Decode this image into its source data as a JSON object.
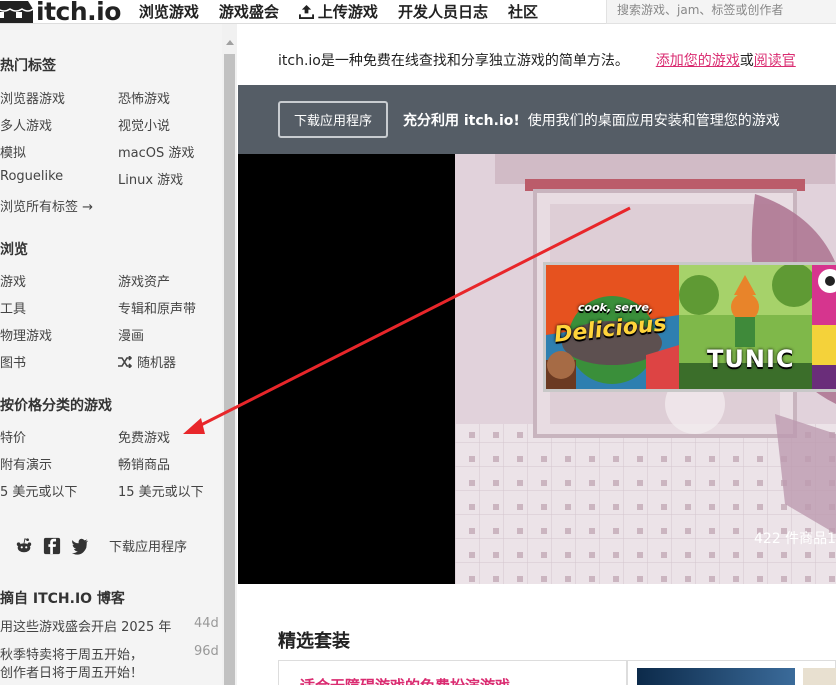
{
  "header": {
    "logo_text": "itch.io",
    "nav": [
      "浏览游戏",
      "游戏盛会",
      "上传游戏",
      "开发人员日志",
      "社区"
    ],
    "search_placeholder": "搜索游戏、jam、标签或创作者"
  },
  "sidebar": {
    "popular_tags": {
      "title": "热门标签",
      "items": [
        "浏览器游戏",
        "恐怖游戏",
        "多人游戏",
        "视觉小说",
        "模拟",
        "macOS 游戏",
        "Roguelike",
        "Linux 游戏"
      ],
      "browse_all": "浏览所有标签 →"
    },
    "browse": {
      "title": "浏览",
      "items": [
        "游戏",
        "游戏资产",
        "工具",
        "专辑和原声带",
        "物理游戏",
        "漫画",
        "图书"
      ],
      "random": "随机器"
    },
    "by_price": {
      "title": "按价格分类的游戏",
      "items": [
        "特价",
        "免费游戏",
        "附有演示",
        "畅销商品",
        "5 美元或以下",
        "15 美元或以下"
      ]
    },
    "social": {
      "icons": [
        "reddit-icon",
        "facebook-icon",
        "twitter-icon"
      ],
      "download_app": "下载应用程序"
    },
    "blog": {
      "title": "摘自 ITCH.IO 博客",
      "posts": [
        {
          "title": "用这些游戏盛会开启 2025 年",
          "age": "44d"
        },
        {
          "title": "秋季特卖将于周五开始，",
          "age": "96d"
        },
        {
          "title": "创作者日将于周五开始！",
          "age": ""
        }
      ]
    }
  },
  "main": {
    "intro": {
      "text": "itch.io是一种免费在线查找和分享独立游戏的简单方法。",
      "link1": "添加您的游戏",
      "or": "或",
      "link2": "阅读官"
    },
    "banner": {
      "button": "下载应用程序",
      "headline": "充分利用 itch.io!",
      "text": "使用我们的桌面应用安装和管理您的游戏"
    },
    "hero": {
      "count_text": "422 件商品1",
      "captions": [
        "Delicious",
        "TUNIC"
      ],
      "cook_serve": "cook, serve,"
    },
    "featured": {
      "title": "精选套装",
      "card_title": "适合无障碍游戏的免费扮演游戏"
    }
  },
  "colors": {
    "accent": "#da2c71",
    "banner": "#555d66",
    "annotation_arrow": "#e8262a"
  }
}
